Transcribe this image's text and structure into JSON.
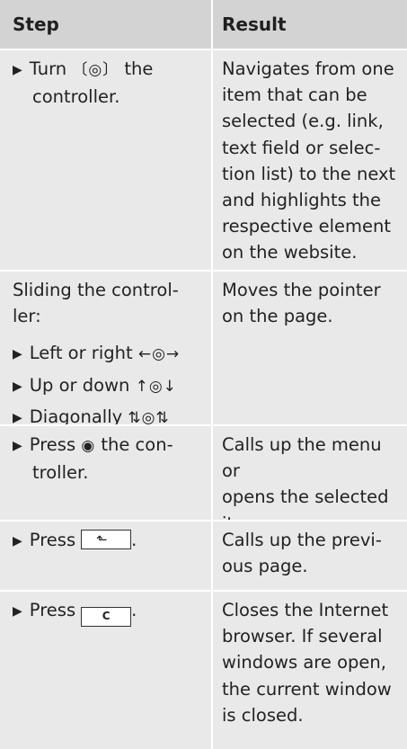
{
  "table": {
    "header": {
      "step": "Step",
      "result": "Result"
    },
    "rows": [
      {
        "step_pre": "Turn",
        "step_symbol": "〔◎〕",
        "step_post_1": "the",
        "step_post_2": "controller.",
        "result": [
          "Navigates from one",
          "item that can be",
          "selected (e.g. link,",
          "text field or selec-",
          "tion list) to the next",
          "and highlights the",
          "respective element",
          "on the website."
        ]
      },
      {
        "step_lines": [
          "Sliding the control-",
          "ler:"
        ],
        "bullets": [
          {
            "label": "Left or right",
            "symbol": "←◎→"
          },
          {
            "label": "Up or down",
            "symbol": "↑◎↓"
          },
          {
            "label": "Diagonally",
            "symbol": "⇅◎⇅"
          }
        ],
        "result": [
          "Moves the pointer",
          "on the page."
        ]
      },
      {
        "step_pre": "Press",
        "step_symbol": "◉",
        "step_post_1": "the con-",
        "step_post_2": "troller.",
        "result": [
          "Calls up the menu or",
          "opens the selected",
          "item."
        ]
      },
      {
        "step_pre": "Press",
        "key_icon": "back-key-icon",
        "key_glyph": "⬑",
        "result": [
          "Calls up the previ-",
          "ous page."
        ]
      },
      {
        "step_pre": "Press",
        "key_icon": "clear-key-icon",
        "key_label": "C",
        "result": [
          "Closes the Internet",
          "browser. If several",
          "windows are open,",
          "the current window",
          "is closed."
        ]
      }
    ]
  }
}
